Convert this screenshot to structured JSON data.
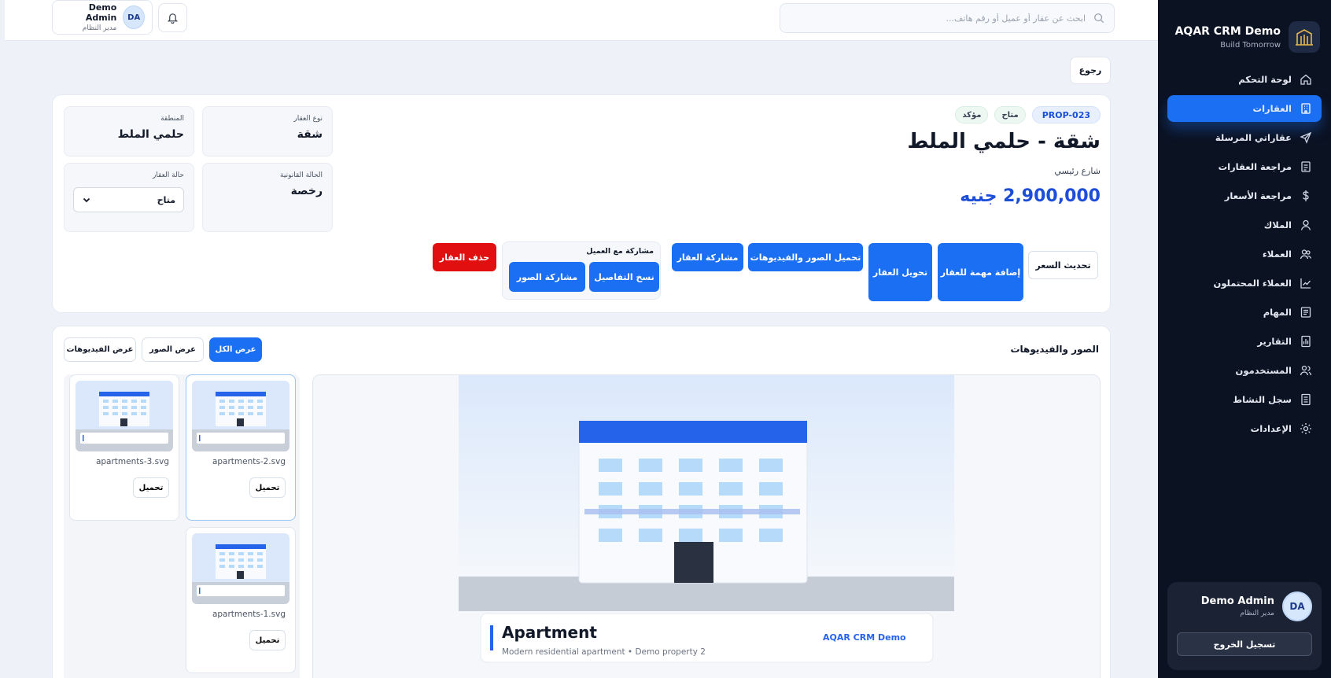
{
  "sidebar": {
    "brand_title": "AQAR CRM Demo",
    "brand_subtitle": "Build Tomorrow",
    "items": [
      {
        "label": "لوحة التحكم",
        "icon": "home-icon"
      },
      {
        "label": "العقارات",
        "icon": "building-icon",
        "active": true
      },
      {
        "label": "عقاراتي المرسلة",
        "icon": "send-icon"
      },
      {
        "label": "مراجعة العقارات",
        "icon": "review-icon"
      },
      {
        "label": "مراجعة الأسعار",
        "icon": "dollar-icon"
      },
      {
        "label": "الملاك",
        "icon": "user-icon"
      },
      {
        "label": "العملاء",
        "icon": "users-icon"
      },
      {
        "label": "العملاء المحتملون",
        "icon": "chart-icon"
      },
      {
        "label": "المهام",
        "icon": "tasks-icon"
      },
      {
        "label": "التقارير",
        "icon": "reports-icon"
      },
      {
        "label": "المستخدمون",
        "icon": "team-icon"
      },
      {
        "label": "سجل النشاط",
        "icon": "log-icon"
      },
      {
        "label": "الإعدادات",
        "icon": "settings-icon"
      }
    ],
    "user": {
      "initials": "DA",
      "name": "Demo Admin",
      "role": "مدير النظام"
    },
    "logout_label": "تسجيل الخروج"
  },
  "topbar": {
    "search_placeholder": "ابحث عن عقار أو عميل أو رقم هاتف...",
    "user": {
      "initials": "DA",
      "name": "Demo Admin",
      "role": "مدير النظام"
    }
  },
  "back_label": "رجوع",
  "property": {
    "code": "PROP-023",
    "badges": [
      "متاح",
      "مؤكد"
    ],
    "title": "شقة - حلمي الملط",
    "street": "شارع رئيسي",
    "price": "2,900,000 جنيه",
    "info": {
      "type_label": "نوع العقار",
      "type_value": "شقة",
      "area_label": "المنطقة",
      "area_value": "حلمي الملط",
      "legal_label": "الحالة القانونية",
      "legal_value": "رخصة",
      "status_label": "حالة العقار",
      "status_value": "متاح"
    },
    "actions": {
      "update_price": "تحديث السعر",
      "add_task": "إضافة مهمة للعقار",
      "transfer": "تحويل العقار",
      "upload_media": "تحميل الصور والفيديوهات",
      "share_property": "مشاركة العقار",
      "share_with_client_label": "مشاركة مع العميل",
      "copy_details": "نسخ التفاصيل",
      "share_photos": "مشاركة الصور",
      "delete": "حذف العقار"
    }
  },
  "media": {
    "title": "الصور والفيديوهات",
    "filters": [
      "عرض الكل",
      "عرض الصور",
      "عرض الفيديوهات"
    ],
    "preview": {
      "caption_title": "Apartment",
      "caption_sub": "Modern residential apartment • Demo property 2",
      "caption_brand": "AQAR CRM Demo"
    },
    "files": [
      {
        "name": "apartments-2.svg",
        "download": "تحميل"
      },
      {
        "name": "apartments-3.svg",
        "download": "تحميل"
      },
      {
        "name": "apartments-1.svg",
        "download": "تحميل"
      }
    ]
  },
  "colors": {
    "accent": "#1a6ff2",
    "sidebar_bg": "#0b1222",
    "danger": "#e10f0f",
    "price": "#1d4ed8"
  }
}
